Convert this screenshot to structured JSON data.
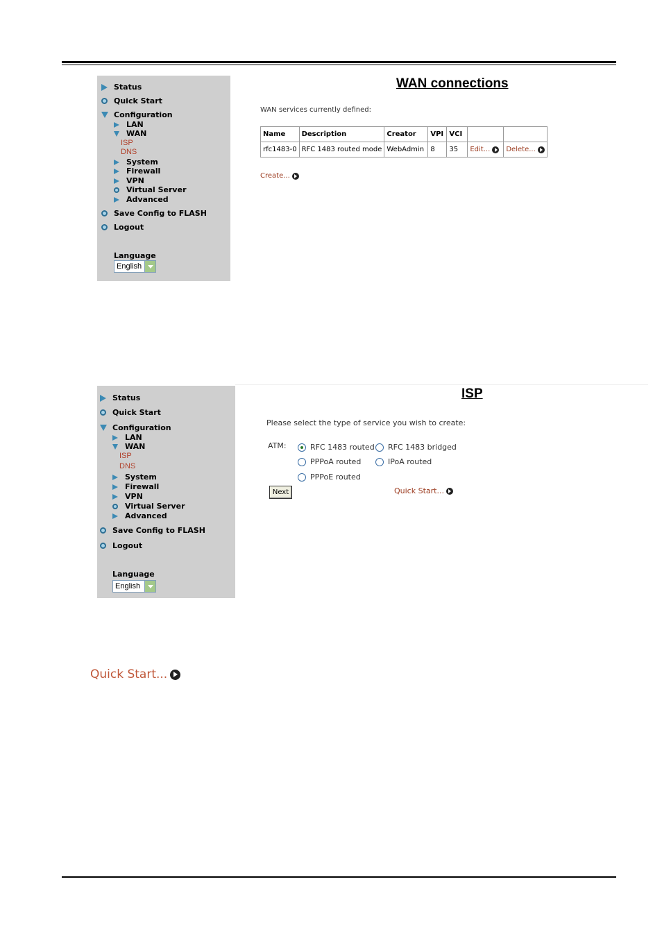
{
  "panel1": {
    "title": "WAN connections",
    "intro": "WAN services currently defined:",
    "nav": {
      "status": "Status",
      "quick_start": "Quick Start",
      "configuration": "Configuration",
      "lan": "LAN",
      "wan": "WAN",
      "isp": "ISP",
      "dns": "DNS",
      "system": "System",
      "firewall": "Firewall",
      "vpn": "VPN",
      "virtual_server": "Virtual Server",
      "advanced": "Advanced",
      "save_config": "Save Config to FLASH",
      "logout": "Logout",
      "language_label": "Language",
      "language_value": "English"
    },
    "table": {
      "headers": [
        "Name",
        "Description",
        "Creator",
        "VPI",
        "VCI",
        "",
        ""
      ],
      "row": {
        "name": "rfc1483-0",
        "description": "RFC 1483 routed mode",
        "creator": "WebAdmin",
        "vpi": "8",
        "vci": "35",
        "edit": "Edit...",
        "delete": "Delete..."
      }
    },
    "create_link": "Create..."
  },
  "panel2": {
    "title": "ISP",
    "intro": "Please select the type of service you wish to create:",
    "atm_label": "ATM:",
    "options": [
      {
        "label": "RFC 1483 routed",
        "selected": true
      },
      {
        "label": "RFC 1483 bridged",
        "selected": false
      },
      {
        "label": "PPPoA routed",
        "selected": false
      },
      {
        "label": "IPoA routed",
        "selected": false
      },
      {
        "label": "PPPoE routed",
        "selected": false
      }
    ],
    "next_button": "Next",
    "quick_start_link": "Quick Start...",
    "nav": {
      "status": "Status",
      "quick_start": "Quick Start",
      "configuration": "Configuration",
      "lan": "LAN",
      "wan": "WAN",
      "isp": "ISP",
      "dns": "DNS",
      "system": "System",
      "firewall": "Firewall",
      "vpn": "VPN",
      "virtual_server": "Virtual Server",
      "advanced": "Advanced",
      "save_config": "Save Config to FLASH",
      "logout": "Logout",
      "language_label": "Language",
      "language_value": "English"
    }
  },
  "quick_start_large": "Quick Start...",
  "colors": {
    "sidebar_bg": "#cfcfcf",
    "link": "#9b3a1e",
    "nav_icon": "#3c8ab4"
  }
}
